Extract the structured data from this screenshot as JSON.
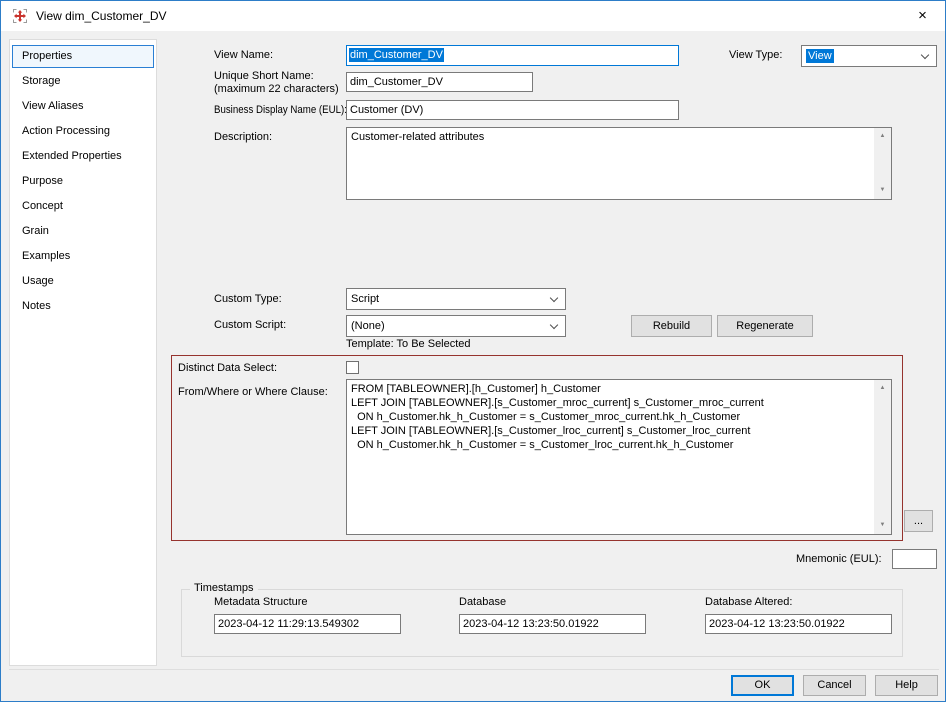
{
  "window": {
    "title": "View dim_Customer_DV"
  },
  "icons": {
    "close": "×",
    "scroll_up": "▲",
    "scroll_down": "▼"
  },
  "sidebar": {
    "items": [
      {
        "label": "Properties",
        "selected": true
      },
      {
        "label": "Storage",
        "selected": false
      },
      {
        "label": "View Aliases",
        "selected": false
      },
      {
        "label": "Action Processing",
        "selected": false
      },
      {
        "label": "Extended Properties",
        "selected": false
      },
      {
        "label": "Purpose",
        "selected": false
      },
      {
        "label": "Concept",
        "selected": false
      },
      {
        "label": "Grain",
        "selected": false
      },
      {
        "label": "Examples",
        "selected": false
      },
      {
        "label": "Usage",
        "selected": false
      },
      {
        "label": "Notes",
        "selected": false
      }
    ]
  },
  "form": {
    "view_name": {
      "label": "View Name:",
      "value": "dim_Customer_DV"
    },
    "view_type": {
      "label": "View Type:",
      "value": "View"
    },
    "unique_short_name": {
      "label": "Unique Short Name:",
      "sublabel": "(maximum 22 characters)",
      "value": "dim_Customer_DV"
    },
    "business_display_name": {
      "label": "Business Display Name (EUL):",
      "value": "Customer (DV)"
    },
    "description": {
      "label": "Description:",
      "value": "Customer-related attributes"
    },
    "custom_type": {
      "label": "Custom Type:",
      "value": "Script"
    },
    "custom_script": {
      "label": "Custom Script:",
      "value": "(None)"
    },
    "rebuild_label": "Rebuild",
    "regenerate_label": "Regenerate",
    "template_note": "Template: To Be Selected",
    "distinct_data_select": {
      "label": "Distinct Data Select:",
      "checked": false
    },
    "from_where": {
      "label": "From/Where or Where Clause:",
      "value": "FROM [TABLEOWNER].[h_Customer] h_Customer\nLEFT JOIN [TABLEOWNER].[s_Customer_mroc_current] s_Customer_mroc_current\n  ON h_Customer.hk_h_Customer = s_Customer_mroc_current.hk_h_Customer\nLEFT JOIN [TABLEOWNER].[s_Customer_lroc_current] s_Customer_lroc_current\n  ON h_Customer.hk_h_Customer = s_Customer_lroc_current.hk_h_Customer"
    },
    "ellipsis_label": "...",
    "mnemonic": {
      "label": "Mnemonic (EUL):",
      "value": ""
    }
  },
  "timestamps": {
    "group_label": "Timestamps",
    "fields": [
      {
        "label": "Metadata Structure",
        "value": "2023-04-12 11:29:13.549302"
      },
      {
        "label": "Database",
        "value": "2023-04-12 13:23:50.01922"
      },
      {
        "label": "Database Altered:",
        "value": "2023-04-12 13:23:50.01922"
      }
    ]
  },
  "footer": {
    "ok_label": "OK",
    "cancel_label": "Cancel",
    "help_label": "Help"
  },
  "colors": {
    "selection": "#0078d7",
    "annotation_outline": "#96332e",
    "titlebar_bg": "#ffffff",
    "dialog_bg": "#f0f0f0"
  }
}
